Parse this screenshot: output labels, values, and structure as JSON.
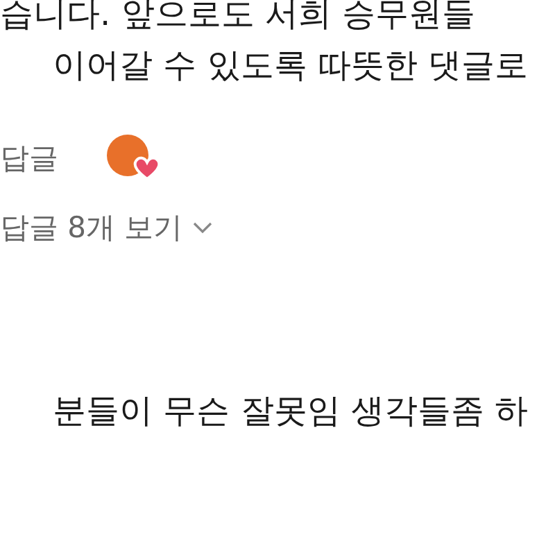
{
  "comments": [
    {
      "text_lines": [
        "습니다. 앞으로도 서희 승무원들",
        "이어갈 수 있도록 따뜻한 댓글로"
      ],
      "reply_button": "답글",
      "creator_heart": true,
      "view_replies": "답글 8개 보기"
    },
    {
      "text_lines": [
        "분들이 무슨 잘못임 생각들좀 하"
      ]
    }
  ]
}
